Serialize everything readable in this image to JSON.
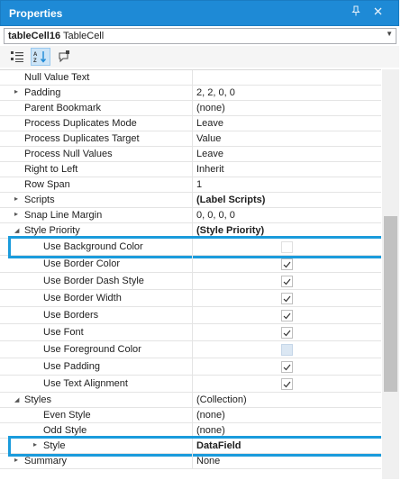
{
  "panel": {
    "title": "Properties"
  },
  "titlebar_icons": [
    "pin-icon",
    "close-icon"
  ],
  "object_selector": {
    "name": "tableCell16",
    "type": "TableCell"
  },
  "toolbar": [
    "categorized-view-icon",
    "alphabetical-sort-icon",
    "property-pages-icon"
  ],
  "rows": [
    {
      "name": "Null Value Text",
      "value": ""
    },
    {
      "name": "Padding",
      "value": "2, 2, 0, 0",
      "expander": "collapsed"
    },
    {
      "name": "Parent Bookmark",
      "value": "(none)"
    },
    {
      "name": "Process Duplicates Mode",
      "value": "Leave"
    },
    {
      "name": "Process Duplicates Target",
      "value": "Value"
    },
    {
      "name": "Process Null Values",
      "value": "Leave"
    },
    {
      "name": "Right to Left",
      "value": "Inherit"
    },
    {
      "name": "Row Span",
      "value": "1"
    },
    {
      "name": "Scripts",
      "value": "(Label Scripts)",
      "bold": true,
      "expander": "collapsed"
    },
    {
      "name": "Snap Line Margin",
      "value": "0, 0, 0, 0",
      "expander": "collapsed"
    },
    {
      "name": "Style Priority",
      "value": "(Style Priority)",
      "bold": true,
      "expander": "expanded"
    },
    {
      "name": "Use Background Color",
      "check": "empty",
      "indent": 2,
      "highlight": true
    },
    {
      "name": "Use Border Color",
      "check": "checked",
      "indent": 2
    },
    {
      "name": "Use Border Dash Style",
      "check": "checked",
      "indent": 2
    },
    {
      "name": "Use Border Width",
      "check": "checked",
      "indent": 2
    },
    {
      "name": "Use Borders",
      "check": "checked",
      "indent": 2
    },
    {
      "name": "Use Font",
      "check": "checked",
      "indent": 2
    },
    {
      "name": "Use Foreground Color",
      "check": "filled",
      "indent": 2
    },
    {
      "name": "Use Padding",
      "check": "checked",
      "indent": 2
    },
    {
      "name": "Use Text Alignment",
      "check": "checked",
      "indent": 2
    },
    {
      "name": "Styles",
      "value": "(Collection)",
      "expander": "expanded"
    },
    {
      "name": "Even Style",
      "value": "(none)",
      "indent": 2
    },
    {
      "name": "Odd Style",
      "value": "(none)",
      "indent": 2
    },
    {
      "name": "Style",
      "value": "DataField",
      "bold": true,
      "indent": 2,
      "expander": "collapsed",
      "highlight": true
    },
    {
      "name": "Summary",
      "value": "None",
      "expander": "collapsed"
    }
  ]
}
